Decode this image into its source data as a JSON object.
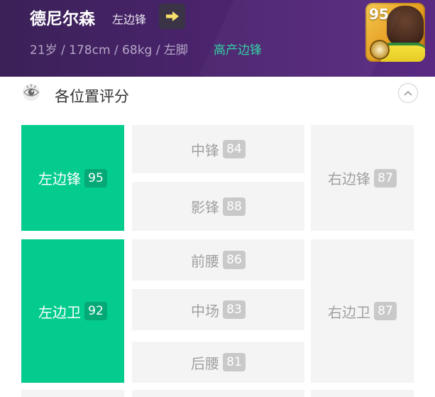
{
  "header": {
    "player_name": "德尼尔森",
    "position": "左边锋",
    "stats": "21岁 / 178cm / 68kg / 左脚",
    "playstyle": "高产边锋",
    "card_rating": "95",
    "arrow_icon": "arrow-right-icon",
    "colors": {
      "accent": "#04cc8e",
      "playstyle": "#2ecfa2",
      "header_bg": "#4c2470"
    }
  },
  "section": {
    "title": "各位置评分",
    "eye_icon": "eye-icon",
    "collapse_icon": "chevron-up-icon"
  },
  "positions": {
    "lwf": {
      "label": "左边锋",
      "score": "95"
    },
    "cf": {
      "label": "中锋",
      "score": "84"
    },
    "ss": {
      "label": "影锋",
      "score": "88"
    },
    "rwf": {
      "label": "右边锋",
      "score": "87"
    },
    "lb": {
      "label": "左边卫",
      "score": "92"
    },
    "amf": {
      "label": "前腰",
      "score": "86"
    },
    "cmf": {
      "label": "中场",
      "score": "83"
    },
    "dmf": {
      "label": "后腰",
      "score": "81"
    },
    "rb": {
      "label": "右边卫",
      "score": "87"
    }
  }
}
